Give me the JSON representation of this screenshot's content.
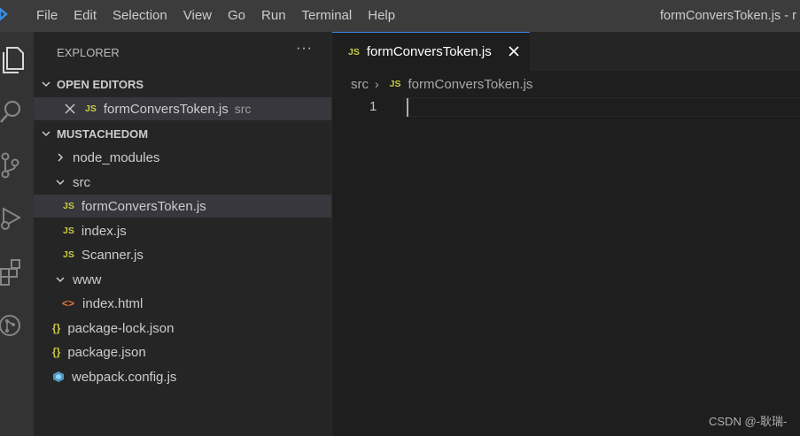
{
  "titlebar": {
    "menu": [
      "File",
      "Edit",
      "Selection",
      "View",
      "Go",
      "Run",
      "Terminal",
      "Help"
    ],
    "window_title": "formConversToken.js - r"
  },
  "activity_bar": {
    "icons": [
      "explorer-icon",
      "search-icon",
      "source-control-icon",
      "run-debug-icon",
      "extensions-icon",
      "git-graph-icon"
    ]
  },
  "sidebar": {
    "title": "EXPLORER",
    "more_label": "···",
    "open_editors": {
      "title": "OPEN EDITORS",
      "items": [
        {
          "icon_label": "JS",
          "name": "formConversToken.js",
          "path": "src"
        }
      ]
    },
    "project": {
      "title": "MUSTACHEDOM",
      "tree": [
        {
          "name": "node_modules",
          "type": "folder",
          "expanded": false
        },
        {
          "name": "src",
          "type": "folder",
          "expanded": true
        },
        {
          "name": "formConversToken.js",
          "type": "js",
          "icon_label": "JS",
          "selected": true
        },
        {
          "name": "index.js",
          "type": "js",
          "icon_label": "JS"
        },
        {
          "name": "Scanner.js",
          "type": "js",
          "icon_label": "JS"
        },
        {
          "name": "www",
          "type": "folder",
          "expanded": true
        },
        {
          "name": "index.html",
          "type": "html",
          "icon_label": "<>"
        },
        {
          "name": "package-lock.json",
          "type": "json",
          "icon_label": "{}"
        },
        {
          "name": "package.json",
          "type": "json",
          "icon_label": "{}"
        },
        {
          "name": "webpack.config.js",
          "type": "webpack"
        }
      ]
    }
  },
  "editor": {
    "tab": {
      "icon_label": "JS",
      "label": "formConversToken.js"
    },
    "breadcrumb": {
      "folder": "src",
      "separator": "›",
      "icon_label": "JS",
      "file": "formConversToken.js"
    },
    "line_number": "1"
  },
  "watermark": "CSDN @-耿瑞-",
  "colors": {
    "accent": "#3a8ee6",
    "js_icon": "#cbcb41",
    "json_icon": "#cbcb41",
    "html_icon": "#e37933",
    "webpack_icon": "#519aba"
  }
}
